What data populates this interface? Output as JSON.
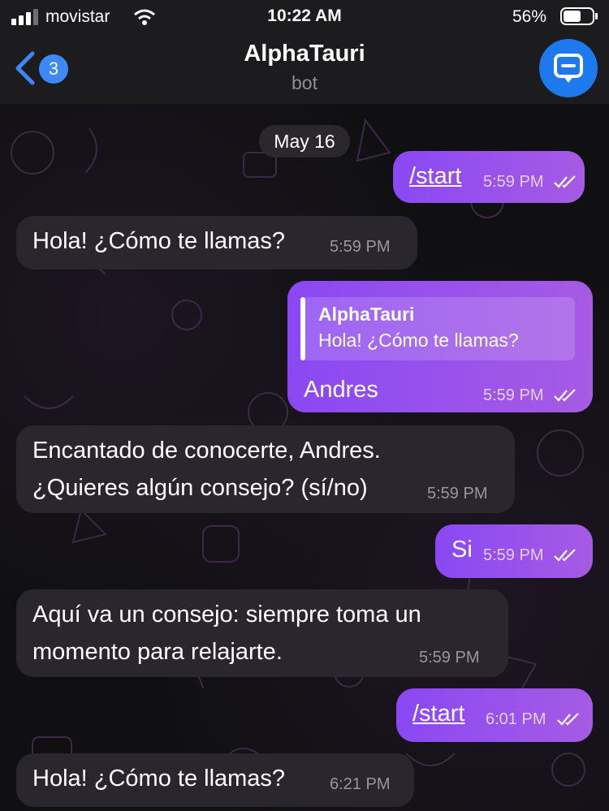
{
  "status_bar": {
    "carrier": "movistar",
    "time": "10:22 AM",
    "battery": "56%"
  },
  "nav": {
    "back_count": "3",
    "title": "AlphaTauri",
    "subtitle": "bot",
    "avatar_icon": "chat-icon"
  },
  "chat": {
    "date": "May 16",
    "messages": [
      {
        "direction": "outgoing",
        "text": "/start",
        "time": "5:59 PM",
        "read": true
      },
      {
        "direction": "incoming",
        "text": "Hola! ¿Cómo te llamas?",
        "time": "5:59 PM"
      },
      {
        "direction": "outgoing",
        "reply_to": {
          "name": "AlphaTauri",
          "text": "Hola! ¿Cómo te llamas?"
        },
        "text": "Andres",
        "time": "5:59 PM",
        "read": true
      },
      {
        "direction": "incoming",
        "lines": [
          "Encantado de conocerte, Andres.",
          "¿Quieres algún consejo? (sí/no)"
        ],
        "time": "5:59 PM"
      },
      {
        "direction": "outgoing",
        "text": "Si",
        "time": "5:59 PM",
        "read": true
      },
      {
        "direction": "incoming",
        "lines": [
          "Aquí va un consejo: siempre toma un",
          "momento para relajarte."
        ],
        "time": "5:59 PM"
      },
      {
        "direction": "outgoing",
        "text": "/start",
        "time": "6:01 PM",
        "read": true
      },
      {
        "direction": "incoming",
        "text": "Hola! ¿Cómo te llamas?",
        "time": "6:21 PM"
      }
    ]
  },
  "colors": {
    "outgoing_bubble": "#9552ec",
    "incoming_bubble": "#2a262d",
    "accent": "#3e88f7"
  }
}
